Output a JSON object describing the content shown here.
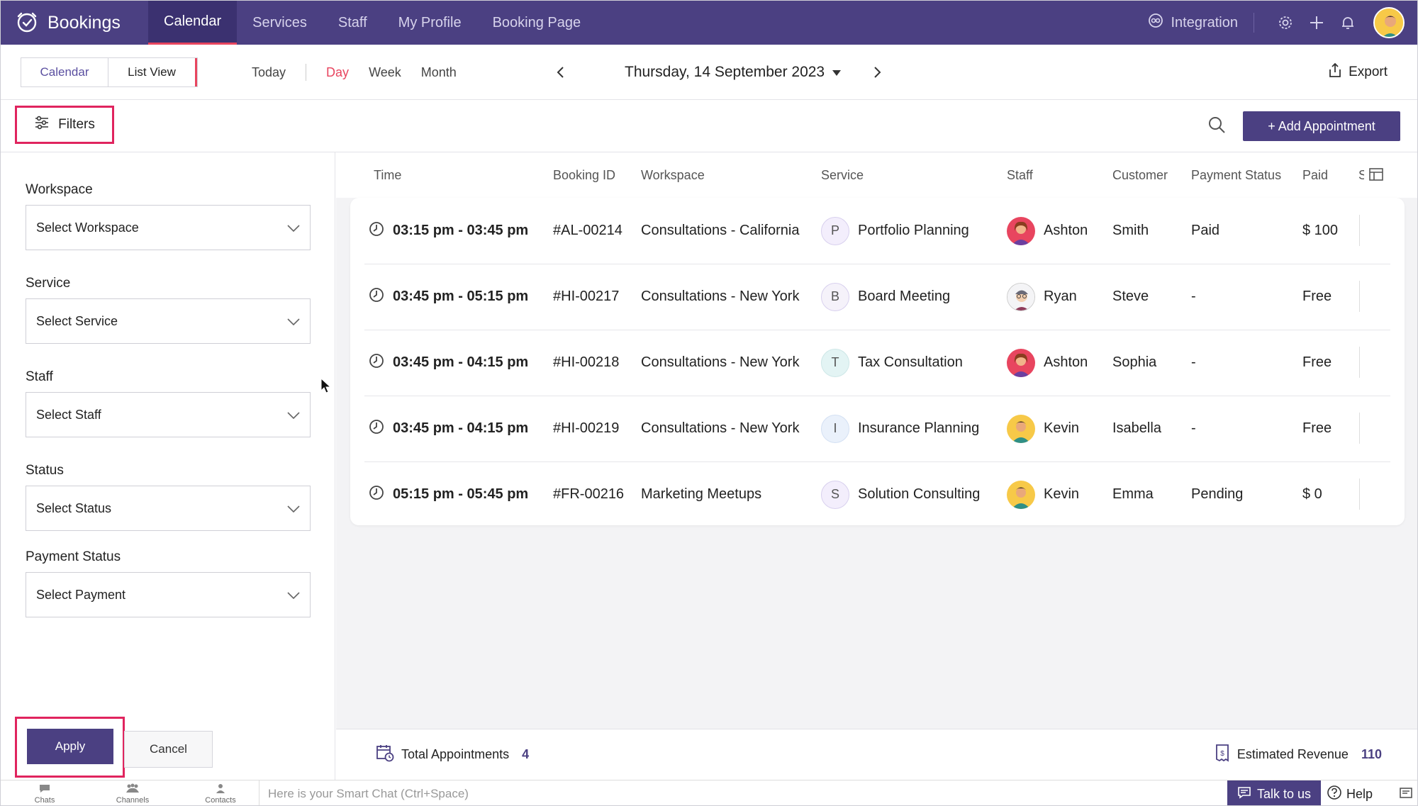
{
  "app": {
    "name": "Bookings"
  },
  "nav": [
    {
      "label": "Calendar"
    },
    {
      "label": "Services"
    },
    {
      "label": "Staff"
    },
    {
      "label": "My Profile"
    },
    {
      "label": "Booking Page"
    }
  ],
  "topright": {
    "integration": "Integration"
  },
  "viewtoggle": {
    "calendar": "Calendar",
    "list": "List View"
  },
  "periods": {
    "today": "Today",
    "day": "Day",
    "week": "Week",
    "month": "Month"
  },
  "date": {
    "label": "Thursday, 14 September 2023"
  },
  "export": "Export",
  "filters": {
    "button": "Filters"
  },
  "add_appointment": "+ Add Appointment",
  "filter_panel": {
    "workspace": {
      "label": "Workspace",
      "placeholder": "Select Workspace"
    },
    "service": {
      "label": "Service",
      "placeholder": "Select Service"
    },
    "staff": {
      "label": "Staff",
      "placeholder": "Select Staff"
    },
    "status": {
      "label": "Status",
      "placeholder": "Select Status"
    },
    "payment": {
      "label": "Payment Status",
      "placeholder": "Select Payment"
    },
    "apply": "Apply",
    "cancel": "Cancel"
  },
  "table": {
    "headers": [
      "Time",
      "Booking ID",
      "Workspace",
      "Service",
      "Staff",
      "Customer",
      "Payment Status",
      "Paid",
      "S"
    ],
    "rows": [
      {
        "time": "03:15 pm - 03:45 pm",
        "id": "#AL-00214",
        "workspace": "Consultations - California",
        "service_initial": "P",
        "service": "Portfolio Planning",
        "staff": "Ashton",
        "customer": "Smith",
        "payment_status": "Paid",
        "paid": "$ 100"
      },
      {
        "time": "03:45 pm - 05:15 pm",
        "id": "#HI-00217",
        "workspace": "Consultations - New York",
        "service_initial": "B",
        "service": "Board Meeting",
        "staff": "Ryan",
        "customer": "Steve",
        "payment_status": "-",
        "paid": "Free"
      },
      {
        "time": "03:45 pm - 04:15 pm",
        "id": "#HI-00218",
        "workspace": "Consultations - New York",
        "service_initial": "T",
        "service": "Tax Consultation",
        "staff": "Ashton",
        "customer": "Sophia",
        "payment_status": "-",
        "paid": "Free"
      },
      {
        "time": "03:45 pm - 04:15 pm",
        "id": "#HI-00219",
        "workspace": "Consultations - New York",
        "service_initial": "I",
        "service": "Insurance Planning",
        "staff": "Kevin",
        "customer": "Isabella",
        "payment_status": "-",
        "paid": "Free"
      },
      {
        "time": "05:15 pm - 05:45 pm",
        "id": "#FR-00216",
        "workspace": "Marketing Meetups",
        "service_initial": "S",
        "service": "Solution Consulting",
        "staff": "Kevin",
        "customer": "Emma",
        "payment_status": "Pending",
        "paid": "$ 0"
      }
    ]
  },
  "summary": {
    "total_label": "Total Appointments",
    "total_value": "4",
    "revenue_label": "Estimated Revenue",
    "revenue_value": "110"
  },
  "bottombar": {
    "chats": "Chats",
    "channels": "Channels",
    "contacts": "Contacts",
    "smartchat_placeholder": "Here is your Smart Chat (Ctrl+Space)",
    "talk": "Talk to us",
    "help": "Help"
  },
  "colors": {
    "primary": "#4b4082",
    "accent": "#e8455f",
    "highlight": "#e0245e"
  }
}
